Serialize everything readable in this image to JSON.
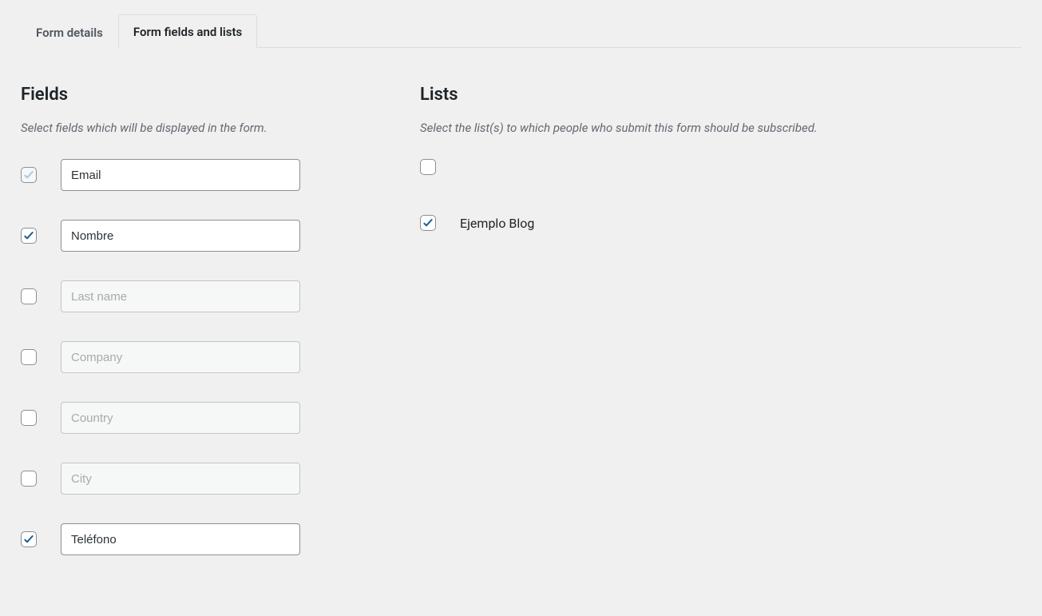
{
  "tabs": {
    "details": "Form details",
    "fields": "Form fields and lists"
  },
  "fieldsSection": {
    "title": "Fields",
    "help": "Select fields which will be displayed in the form.",
    "rows": [
      {
        "checked": true,
        "locked": true,
        "value": "Email",
        "placeholder": "",
        "enabled": true
      },
      {
        "checked": true,
        "locked": false,
        "value": "Nombre",
        "placeholder": "",
        "enabled": true
      },
      {
        "checked": false,
        "locked": false,
        "value": "",
        "placeholder": "Last name",
        "enabled": false
      },
      {
        "checked": false,
        "locked": false,
        "value": "",
        "placeholder": "Company",
        "enabled": false
      },
      {
        "checked": false,
        "locked": false,
        "value": "",
        "placeholder": "Country",
        "enabled": false
      },
      {
        "checked": false,
        "locked": false,
        "value": "",
        "placeholder": "City",
        "enabled": false
      },
      {
        "checked": true,
        "locked": false,
        "value": "Teléfono",
        "placeholder": "",
        "enabled": true
      }
    ]
  },
  "listsSection": {
    "title": "Lists",
    "help": "Select the list(s) to which people who submit this form should be subscribed.",
    "rows": [
      {
        "checked": false,
        "label": ""
      },
      {
        "checked": true,
        "label": "Ejemplo Blog"
      }
    ]
  }
}
